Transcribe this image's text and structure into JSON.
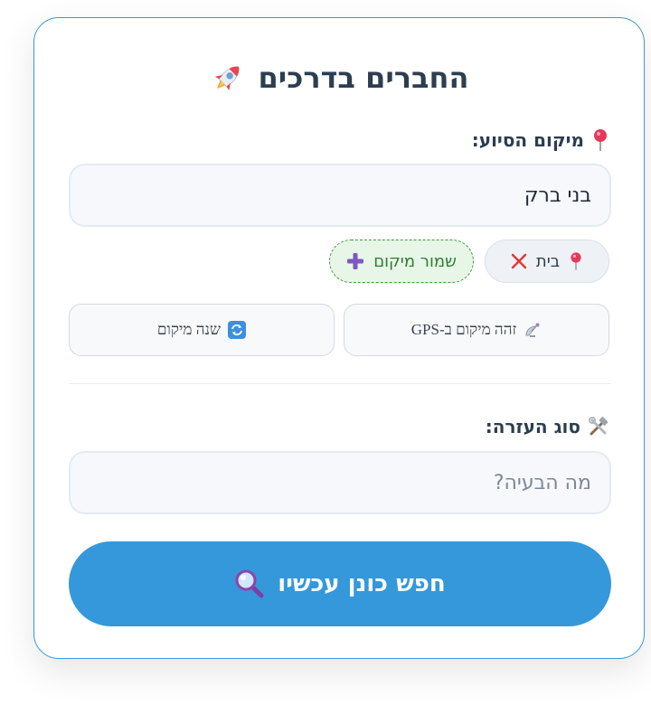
{
  "header": {
    "title": "החברים בדרכים",
    "icon": "rocket-icon"
  },
  "location": {
    "label": "מיקום הסיוע:",
    "icon": "pin-icon",
    "value": "בני ברק",
    "saved_chip": {
      "label": "בית",
      "icon": "pin-icon",
      "remove_icon": "close-icon"
    },
    "save_button": {
      "label": "שמור מיקום",
      "icon": "plus-icon"
    },
    "gps_button": {
      "label": "זהה מיקום ב-GPS",
      "icon": "satellite-icon"
    },
    "change_button": {
      "label": "שנה מיקום",
      "icon": "refresh-icon"
    }
  },
  "help_type": {
    "label": "סוג העזרה:",
    "icon": "tools-icon",
    "placeholder": "מה הבעיה?",
    "value": ""
  },
  "search_button": {
    "label": "חפש כונן עכשיו",
    "icon": "magnifier-icon"
  },
  "colors": {
    "accent": "#3498db",
    "title": "#2c3e50",
    "save_green": "#2e7d32",
    "close_red": "#e53935"
  }
}
